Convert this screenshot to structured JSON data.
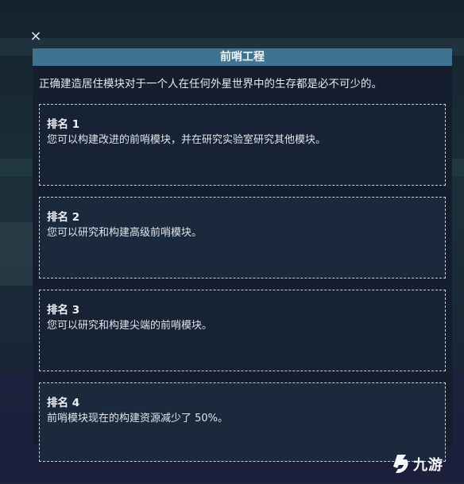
{
  "dialog": {
    "close_glyph": "×",
    "title": "前哨工程",
    "description": "正确建造居住模块对于一个人在任何外星世界中的生存都是必不可少的。",
    "ranks": [
      {
        "title": "排名 1",
        "text": "您可以构建改进的前哨模块，并在研究实验室研究其他模块。"
      },
      {
        "title": "排名 2",
        "text": "您可以研究和构建高级前哨模块。"
      },
      {
        "title": "排名 3",
        "text": "您可以研究和构建尖端的前哨模块。"
      },
      {
        "title": "排名 4",
        "text": "前哨模块现在的构建资源减少了 50%。"
      }
    ]
  },
  "watermark": {
    "text": "九游",
    "icon": "jiuyou-logo-icon"
  },
  "colors": {
    "title_bar": "#3e7391",
    "panel_bg": "#141e2e",
    "card_border": "#c9d0d6"
  }
}
